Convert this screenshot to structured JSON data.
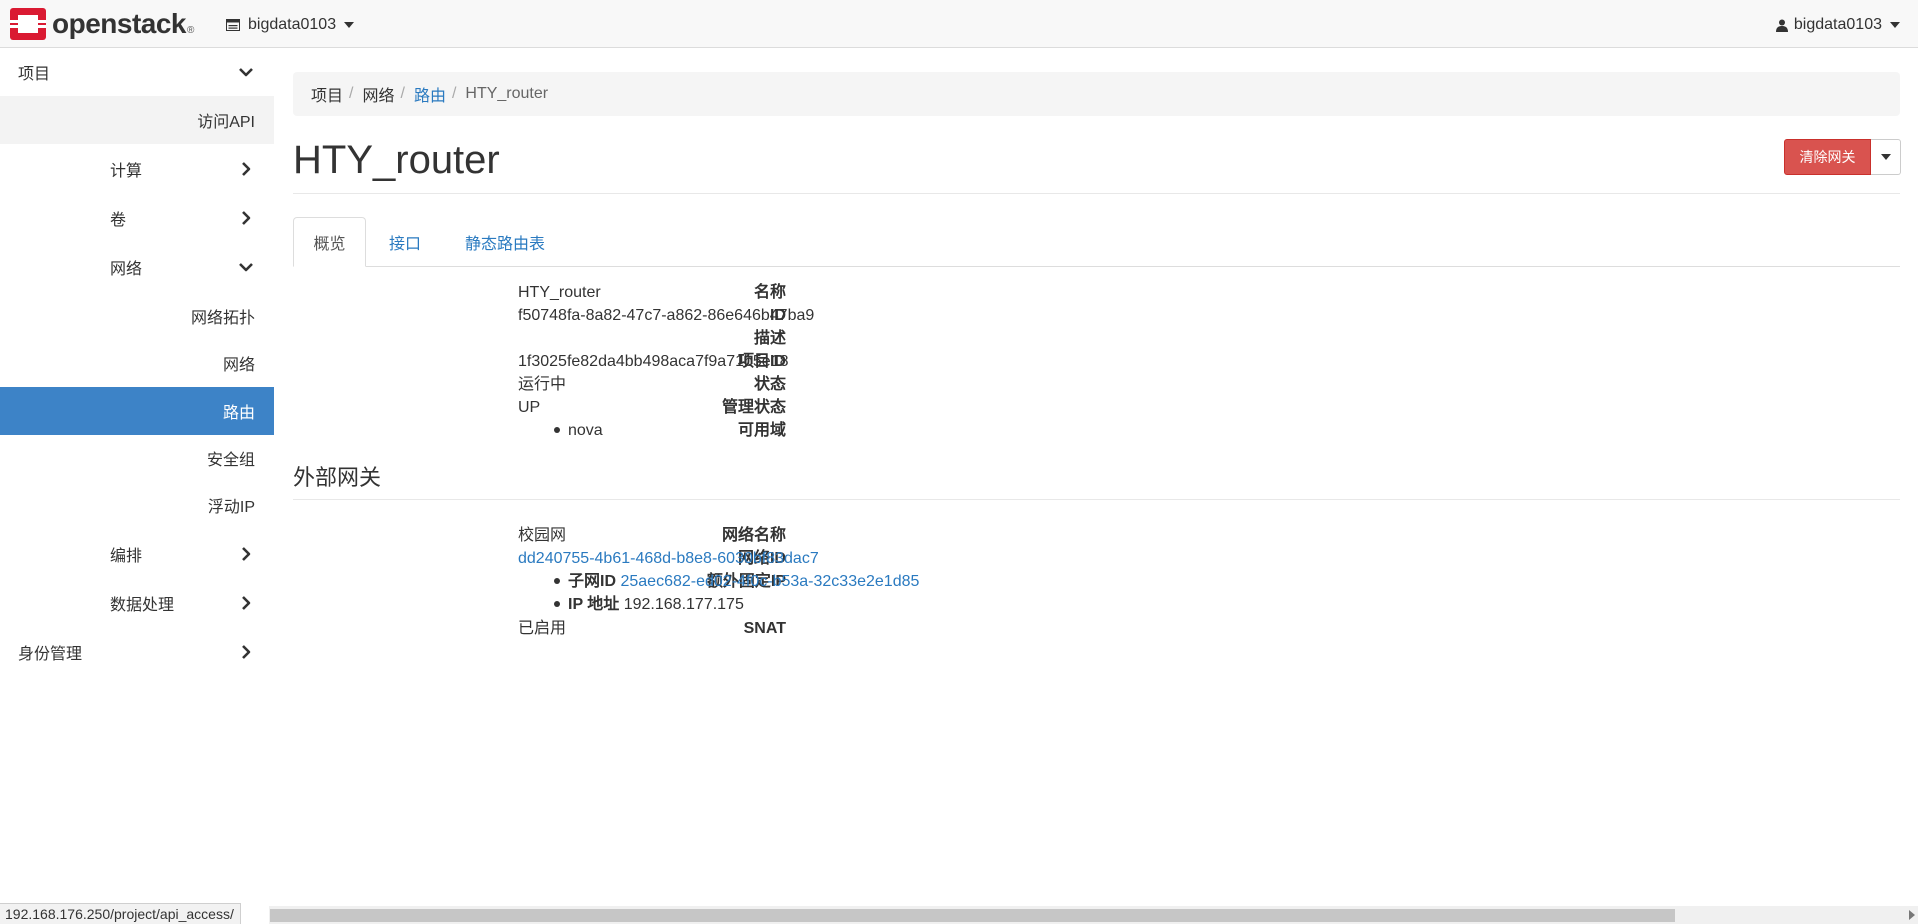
{
  "brand": {
    "name": "openstack",
    "reg": "®"
  },
  "topbar": {
    "project_label": "bigdata0103",
    "user_label": "bigdata0103"
  },
  "sidebar": {
    "items": [
      {
        "label": "项目",
        "icon": "chevron-down-icon"
      },
      {
        "label": "访问API"
      },
      {
        "label": "计算",
        "icon": "chevron-right-icon"
      },
      {
        "label": "卷",
        "icon": "chevron-right-icon"
      },
      {
        "label": "网络",
        "icon": "chevron-down-icon"
      },
      {
        "label": "网络拓扑"
      },
      {
        "label": "网络"
      },
      {
        "label": "路由",
        "active": true
      },
      {
        "label": "安全组"
      },
      {
        "label": "浮动IP"
      },
      {
        "label": "编排",
        "icon": "chevron-right-icon"
      },
      {
        "label": "数据处理",
        "icon": "chevron-right-icon"
      },
      {
        "label": "身份管理",
        "icon": "chevron-right-icon"
      }
    ]
  },
  "breadcrumb": {
    "items": [
      "项目",
      "网络",
      "路由",
      "HTY_router"
    ],
    "sep": "/"
  },
  "page": {
    "title": "HTY_router",
    "clear_gateway_button": "清除网关"
  },
  "tabs": [
    "概览",
    "接口",
    "静态路由表"
  ],
  "overview": {
    "name_label": "名称",
    "name": "HTY_router",
    "id_label": "ID",
    "id": "f50748fa-8a82-47c7-a862-86e646b47ba9",
    "description_label": "描述",
    "description": "",
    "project_id_label": "项目ID",
    "project_id": "1f3025fe82da4bb498aca7f9a71b5e18",
    "status_label": "状态",
    "status": "运行中",
    "admin_state_label": "管理状态",
    "admin_state": "UP",
    "az_label": "可用域",
    "az": "nova"
  },
  "external_gateway": {
    "title": "外部网关",
    "network_name_label": "网络名称",
    "network_name": "校园网",
    "network_id_label": "网络ID",
    "network_id": "dd240755-4b61-468d-b8e8-6030bf83dac7",
    "fixed_ip_label": "额外固定IP",
    "subnet_id_label": "子网ID",
    "subnet_id": "25aec682-ed02-4f0c-b53a-32c33e2e1d85",
    "ip_address_label": "IP 地址",
    "ip_address": "192.168.177.175",
    "snat_label": "SNAT",
    "snat": "已启用"
  },
  "statusbar": {
    "url": "192.168.176.250/project/api_access/"
  },
  "colors": {
    "accent": "#3d83c7",
    "danger": "#d9534f",
    "link": "#2a7ac0",
    "brand_red": "#da1a32"
  }
}
